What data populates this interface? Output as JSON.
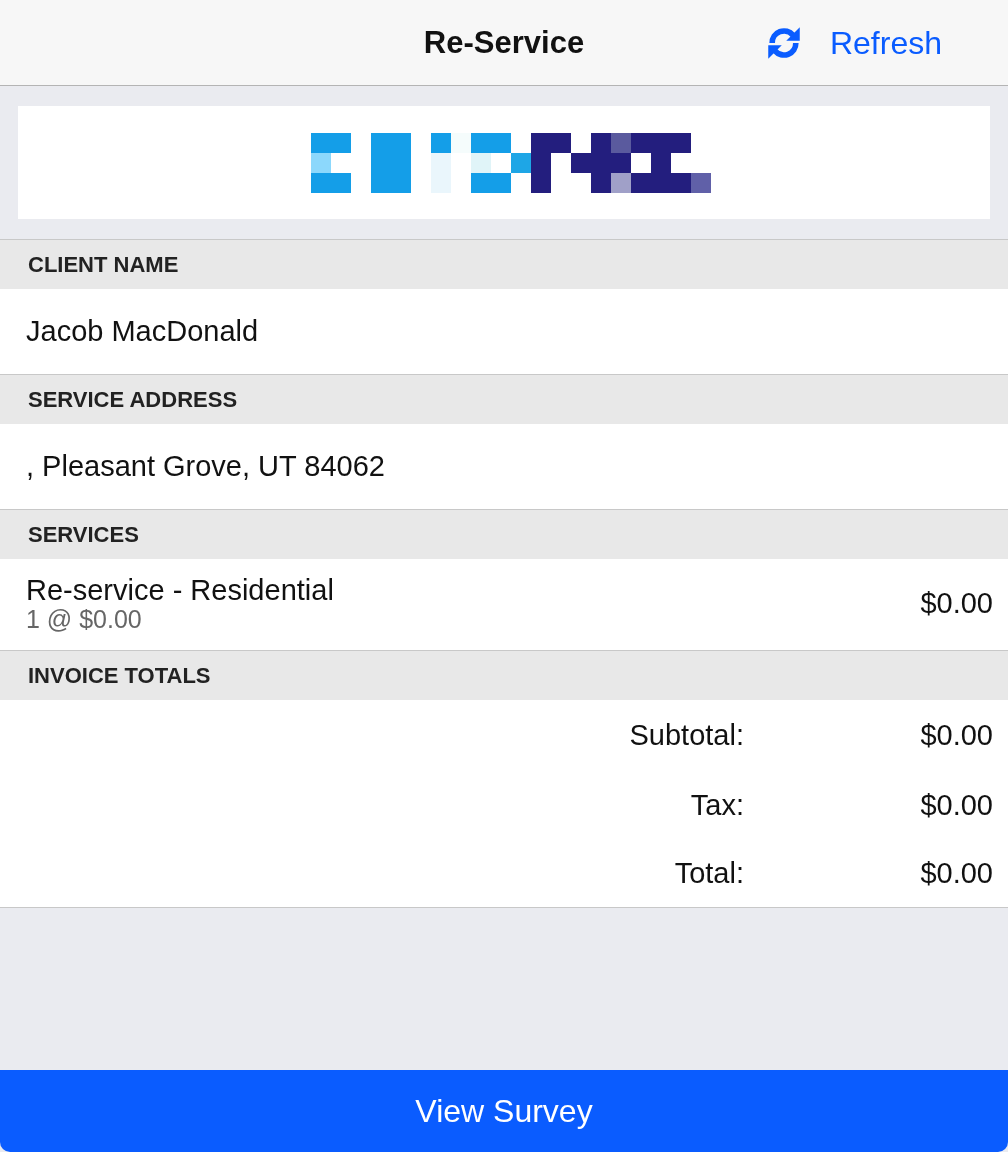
{
  "header": {
    "title": "Re-Service",
    "refresh_button": {
      "label": "Refresh"
    }
  },
  "sections": [
    {
      "kind": "text",
      "heading": "CLIENT NAME",
      "value": "Jacob MacDonald"
    },
    {
      "kind": "text",
      "heading": "SERVICE ADDRESS",
      "value": ", Pleasant Grove, UT 84062"
    },
    {
      "kind": "services",
      "heading": "SERVICES",
      "items": [
        {
          "name": "Re-service - Residential",
          "detail": "1 @ $0.00",
          "amount": "$0.00"
        }
      ]
    },
    {
      "kind": "totals",
      "heading": "INVOICE TOTALS",
      "rows": [
        {
          "label": "Subtotal:",
          "value": "$0.00"
        },
        {
          "label": "Tax:",
          "value": "$0.00"
        },
        {
          "label": "Total:",
          "value": "$0.00"
        }
      ]
    }
  ],
  "footer_button": {
    "label": "View Survey"
  }
}
